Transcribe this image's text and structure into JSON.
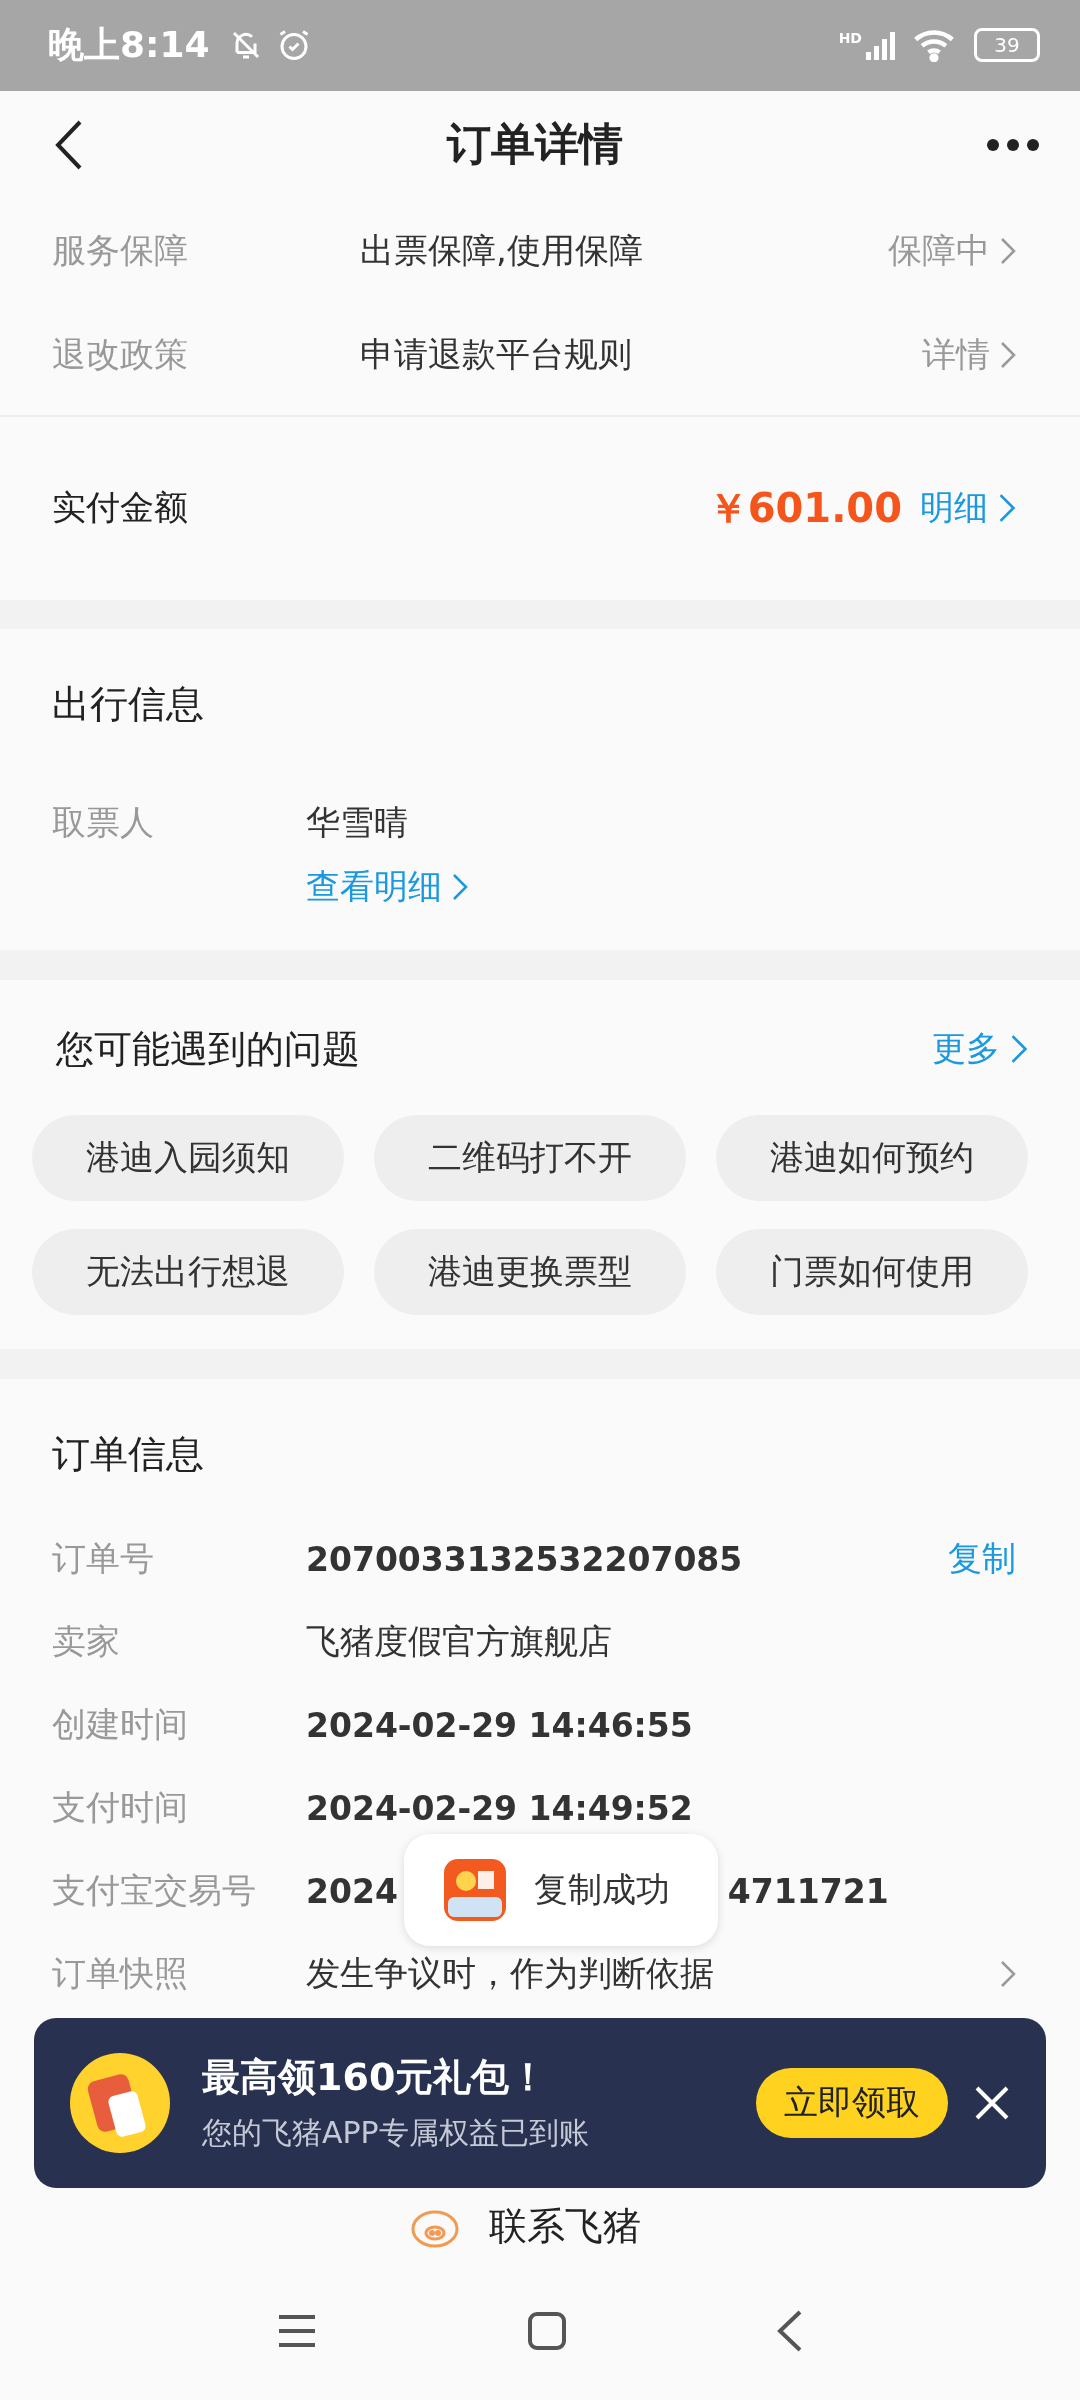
{
  "status_bar": {
    "time": "晚上8:14",
    "network": "HD",
    "battery": "39"
  },
  "header": {
    "title": "订单详情"
  },
  "top_rows": [
    {
      "label": "服务保障",
      "value": "出票保障,使用保障",
      "action": "保障中"
    },
    {
      "label": "退改政策",
      "value": "申请退款平台规则",
      "action": "详情"
    }
  ],
  "payment": {
    "label": "实付金额",
    "amount": "￥601.00",
    "link": "明细"
  },
  "travel_info": {
    "title": "出行信息",
    "label": "取票人",
    "name": "华雪晴",
    "link": "查看明细"
  },
  "questions": {
    "title": "您可能遇到的问题",
    "more": "更多",
    "chips": [
      "港迪入园须知",
      "二维码打不开",
      "港迪如何预约",
      "无法出行想退",
      "港迪更换票型",
      "门票如何使用"
    ]
  },
  "order_info": {
    "title": "订单信息",
    "rows": [
      {
        "kind": "copy",
        "label": "订单号",
        "value": "2070033132532207085",
        "action": "复制"
      },
      {
        "kind": "plain",
        "label": "卖家",
        "value": "飞猪度假官方旗舰店"
      },
      {
        "kind": "bold",
        "label": "创建时间",
        "value": "2024-02-29 14:46:55"
      },
      {
        "kind": "bold",
        "label": "支付时间",
        "value": "2024-02-29 14:49:52"
      },
      {
        "kind": "split",
        "label": "支付宝交易号",
        "value": "2024",
        "value_end": "4711721"
      },
      {
        "kind": "link",
        "label": "订单快照",
        "value": "发生争议时，作为判断依据"
      }
    ]
  },
  "toast": {
    "text": "复制成功"
  },
  "banner": {
    "title": "最高领160元礼包！",
    "subtitle": "您的飞猪APP专属权益已到账",
    "button": "立即领取"
  },
  "contact": {
    "label": "联系飞猪"
  }
}
